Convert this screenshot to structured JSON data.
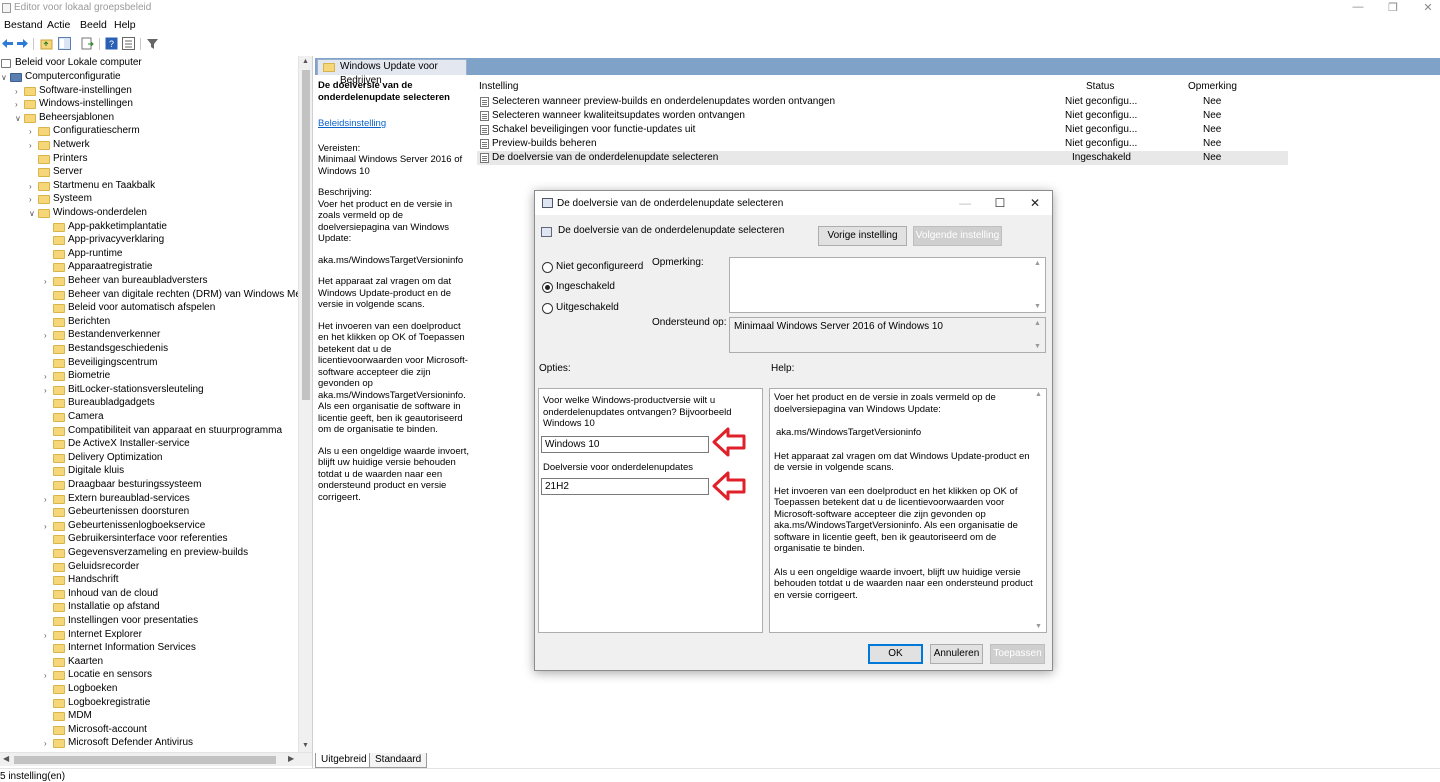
{
  "window": {
    "title": "Editor voor lokaal groepsbeleid"
  },
  "menu": [
    "Bestand",
    "Actie",
    "Beeld",
    "Help"
  ],
  "tree": {
    "root": "Beleid voor Lokale computer",
    "nodes": [
      {
        "label": "Computerconfiguratie",
        "level": 1,
        "expanded": true
      },
      {
        "label": "Software-instellingen",
        "level": 2,
        "expander": true
      },
      {
        "label": "Windows-instellingen",
        "level": 2,
        "expander": true
      },
      {
        "label": "Beheersjablonen",
        "level": 2,
        "expanded": true
      },
      {
        "label": "Configuratiescherm",
        "level": 3,
        "expander": true
      },
      {
        "label": "Netwerk",
        "level": 3,
        "expander": true
      },
      {
        "label": "Printers",
        "level": 3
      },
      {
        "label": "Server",
        "level": 3
      },
      {
        "label": "Startmenu en Taakbalk",
        "level": 3,
        "expander": true
      },
      {
        "label": "Systeem",
        "level": 3,
        "expander": true
      },
      {
        "label": "Windows-onderdelen",
        "level": 3,
        "expanded": true
      },
      {
        "label": "App-pakketimplantatie",
        "level": 4
      },
      {
        "label": "App-privacyverklaring",
        "level": 4
      },
      {
        "label": "App-runtime",
        "level": 4
      },
      {
        "label": "Apparaatregistratie",
        "level": 4
      },
      {
        "label": "Beheer van bureaubladversters",
        "level": 4,
        "expander": true
      },
      {
        "label": "Beheer van digitale rechten (DRM) van Windows Media",
        "level": 4
      },
      {
        "label": "Beleid voor automatisch afspelen",
        "level": 4
      },
      {
        "label": "Berichten",
        "level": 4
      },
      {
        "label": "Bestandenverkenner",
        "level": 4,
        "expander": true
      },
      {
        "label": "Bestandsgeschiedenis",
        "level": 4
      },
      {
        "label": "Beveiligingscentrum",
        "level": 4
      },
      {
        "label": "Biometrie",
        "level": 4,
        "expander": true
      },
      {
        "label": "BitLocker-stationsversleuteling",
        "level": 4,
        "expander": true
      },
      {
        "label": "Bureaubladgadgets",
        "level": 4
      },
      {
        "label": "Camera",
        "level": 4
      },
      {
        "label": "Compatibiliteit van apparaat en stuurprogramma",
        "level": 4
      },
      {
        "label": "De ActiveX Installer-service",
        "level": 4
      },
      {
        "label": "Delivery Optimization",
        "level": 4
      },
      {
        "label": "Digitale kluis",
        "level": 4
      },
      {
        "label": "Draagbaar  besturingssysteem",
        "level": 4
      },
      {
        "label": "Extern bureaublad-services",
        "level": 4,
        "expander": true
      },
      {
        "label": "Gebeurtenissen doorsturen",
        "level": 4
      },
      {
        "label": "Gebeurtenissenlogboekservice",
        "level": 4,
        "expander": true
      },
      {
        "label": "Gebruikersinterface voor referenties",
        "level": 4
      },
      {
        "label": "Gegevensverzameling en preview-builds",
        "level": 4
      },
      {
        "label": "Geluidsrecorder",
        "level": 4
      },
      {
        "label": "Handschrift",
        "level": 4
      },
      {
        "label": "Inhoud van de cloud",
        "level": 4
      },
      {
        "label": "Installatie op afstand",
        "level": 4
      },
      {
        "label": "Instellingen voor presentaties",
        "level": 4
      },
      {
        "label": "Internet Explorer",
        "level": 4,
        "expander": true
      },
      {
        "label": "Internet Information Services",
        "level": 4
      },
      {
        "label": "Kaarten",
        "level": 4
      },
      {
        "label": "Locatie en sensors",
        "level": 4,
        "expander": true
      },
      {
        "label": "Logboeken",
        "level": 4
      },
      {
        "label": "Logboekregistratie",
        "level": 4
      },
      {
        "label": "MDM",
        "level": 4
      },
      {
        "label": "Microsoft-account",
        "level": 4
      },
      {
        "label": "Microsoft Defender Antivirus",
        "level": 4,
        "expander": true
      }
    ]
  },
  "pane": {
    "tab": "Windows Update voor Bedrijven",
    "desc": {
      "heading": "De doelversie van de onderdelenupdate selecteren",
      "link": "Beleidsinstelling",
      "requirements": "Vereisten:\nMinimaal Windows Server 2016 of Windows 10",
      "description": "Beschrijving:\nVoer het product en de versie in zoals vermeld op de doelversiepagina van Windows Update:",
      "url": "aka.ms/WindowsTargetVersioninfo",
      "p1": "Het apparaat zal vragen om dat Windows Update-product en de versie in volgende scans.",
      "p2": "Het invoeren van een doelproduct en het klikken op OK of Toepassen betekent dat u de licentievoorwaarden voor Microsoft-software accepteer die zijn gevonden op aka.ms/WindowsTargetVersioninfo. Als een organisatie de software in licentie geeft, ben ik geautoriseerd om de organisatie te binden.",
      "p3": "Als u een ongeldige waarde invoert, blijft uw huidige versie behouden totdat u de waarden naar een ondersteund product en versie corrigeert."
    },
    "columns": {
      "setting": "Instelling",
      "status": "Status",
      "remark": "Opmerking"
    },
    "rows": [
      {
        "name": "Selecteren wanneer preview-builds en onderdelenupdates worden ontvangen",
        "status": "Niet geconfigu...",
        "remark": "Nee"
      },
      {
        "name": "Selecteren wanneer kwaliteitsupdates worden ontvangen",
        "status": "Niet geconfigu...",
        "remark": "Nee"
      },
      {
        "name": "Schakel beveiligingen voor functie-updates uit",
        "status": "Niet geconfigu...",
        "remark": "Nee"
      },
      {
        "name": "Preview-builds beheren",
        "status": "Niet geconfigu...",
        "remark": "Nee"
      },
      {
        "name": "De doelversie van de onderdelenupdate selecteren",
        "status": "Ingeschakeld",
        "remark": "Nee"
      }
    ]
  },
  "tabs": {
    "extended": "Uitgebreid",
    "standard": "Standaard"
  },
  "status": "5 instelling(en)",
  "dialog": {
    "title": "De doelversie van de onderdelenupdate selecteren",
    "subtitle": "De doelversie van de onderdelenupdate selecteren",
    "prev_button": "Vorige instelling",
    "next_button": "Volgende instelling",
    "radios": {
      "not_configured": "Niet geconfigureerd",
      "enabled": "Ingeschakeld",
      "disabled": "Uitgeschakeld",
      "selected": "enabled"
    },
    "remark_label": "Opmerking:",
    "supported_label": "Ondersteund op:",
    "supported_value": "Minimaal Windows Server 2016 of Windows 10",
    "options_label": "Opties:",
    "help_label": "Help:",
    "option_question": "Voor welke Windows-productversie wilt u onderdelenupdates ontvangen? Bijvoorbeeld Windows 10",
    "product_value": "Windows 10",
    "target_label": "Doelversie voor onderdelenupdates",
    "target_value": "21H2",
    "help": {
      "p1": "Voer het product en de versie in zoals vermeld op de doelversiepagina van Windows Update:",
      "p2": "aka.ms/WindowsTargetVersioninfo",
      "p3": "Het apparaat zal vragen om dat Windows Update-product en de versie in volgende scans.",
      "p4": "Het invoeren van een doelproduct en het klikken op OK of Toepassen betekent dat u de licentievoorwaarden voor Microsoft-software accepteer die zijn gevonden op aka.ms/WindowsTargetVersioninfo. Als een organisatie de software in licentie geeft, ben ik geautoriseerd om de organisatie te binden.",
      "p5": "Als u een ongeldige waarde invoert, blijft uw huidige versie behouden totdat u de waarden naar een ondersteund product en versie corrigeert."
    },
    "ok": "OK",
    "cancel": "Annuleren",
    "apply": "Toepassen"
  },
  "colors": {
    "header": "#7fa2c9",
    "arrow": "#e0202a",
    "link": "#0a63c9"
  }
}
